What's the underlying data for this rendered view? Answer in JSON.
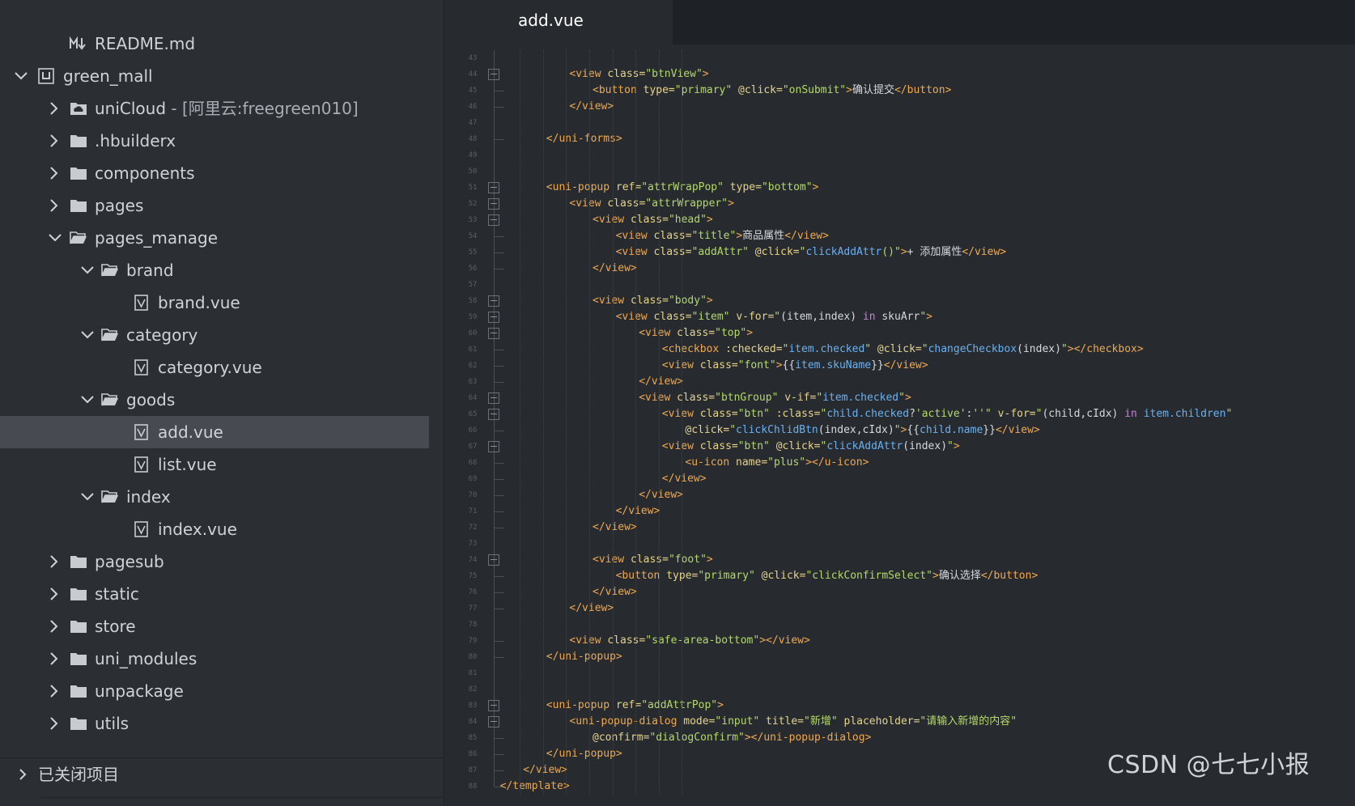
{
  "sidebar": {
    "tree": [
      {
        "label": "README.md",
        "icon": "markdown-icon",
        "depth": 2,
        "chevron": "none"
      },
      {
        "label": "green_mall",
        "icon": "project-icon",
        "depth": 1,
        "chevron": "down"
      },
      {
        "label": "uniCloud",
        "suffix": " - [阿里云:freegreen010]",
        "icon": "cloud-folder-icon",
        "depth": 2,
        "chevron": "right"
      },
      {
        "label": ".hbuilderx",
        "icon": "folder-icon",
        "depth": 2,
        "chevron": "right"
      },
      {
        "label": "components",
        "icon": "folder-icon",
        "depth": 2,
        "chevron": "right"
      },
      {
        "label": "pages",
        "icon": "folder-icon",
        "depth": 2,
        "chevron": "right"
      },
      {
        "label": "pages_manage",
        "icon": "folder-open-icon",
        "depth": 2,
        "chevron": "down"
      },
      {
        "label": "brand",
        "icon": "folder-open-icon",
        "depth": 3,
        "chevron": "down"
      },
      {
        "label": "brand.vue",
        "icon": "vue-file-icon",
        "depth": 4,
        "chevron": "none"
      },
      {
        "label": "category",
        "icon": "folder-open-icon",
        "depth": 3,
        "chevron": "down"
      },
      {
        "label": "category.vue",
        "icon": "vue-file-icon",
        "depth": 4,
        "chevron": "none"
      },
      {
        "label": "goods",
        "icon": "folder-open-icon",
        "depth": 3,
        "chevron": "down"
      },
      {
        "label": "add.vue",
        "icon": "vue-file-icon",
        "depth": 4,
        "chevron": "none",
        "selected": true
      },
      {
        "label": "list.vue",
        "icon": "vue-file-icon",
        "depth": 4,
        "chevron": "none"
      },
      {
        "label": "index",
        "icon": "folder-open-icon",
        "depth": 3,
        "chevron": "down"
      },
      {
        "label": "index.vue",
        "icon": "vue-file-icon",
        "depth": 4,
        "chevron": "none"
      },
      {
        "label": "pagesub",
        "icon": "folder-icon",
        "depth": 2,
        "chevron": "right"
      },
      {
        "label": "static",
        "icon": "folder-icon",
        "depth": 2,
        "chevron": "right"
      },
      {
        "label": "store",
        "icon": "folder-icon",
        "depth": 2,
        "chevron": "right"
      },
      {
        "label": "uni_modules",
        "icon": "folder-icon",
        "depth": 2,
        "chevron": "right"
      },
      {
        "label": "unpackage",
        "icon": "folder-icon",
        "depth": 2,
        "chevron": "right"
      },
      {
        "label": "utils",
        "icon": "folder-icon",
        "depth": 2,
        "chevron": "right"
      }
    ],
    "closed_projects_label": "已关闭项目"
  },
  "editor": {
    "tab_label": "add.vue",
    "first_line_number": 43,
    "fold_lines": [
      44,
      51,
      52,
      53,
      58,
      59,
      60,
      64,
      65,
      67,
      74,
      83,
      84
    ],
    "lines": [
      [],
      [
        [
          "t",
          "<view"
        ],
        [
          "a",
          " class="
        ],
        [
          "s",
          "\"btnView\""
        ],
        [
          "t",
          ">"
        ]
      ],
      [
        [
          "t",
          "<button"
        ],
        [
          "a",
          " type="
        ],
        [
          "s",
          "\"primary\""
        ],
        [
          "a",
          " @click="
        ],
        [
          "s",
          "\"onSubmit\""
        ],
        [
          "t",
          ">"
        ],
        [
          "x",
          "确认提交"
        ],
        [
          "t",
          "</button>"
        ]
      ],
      [
        [
          "t",
          "</view>"
        ]
      ],
      [],
      [
        [
          "t",
          "</uni-forms>"
        ]
      ],
      [],
      [],
      [
        [
          "t",
          "<uni-popup"
        ],
        [
          "a",
          " ref="
        ],
        [
          "s",
          "\"attrWrapPop\""
        ],
        [
          "a",
          " type="
        ],
        [
          "s",
          "\"bottom\""
        ],
        [
          "t",
          ">"
        ]
      ],
      [
        [
          "t",
          "<view"
        ],
        [
          "a",
          " class="
        ],
        [
          "s",
          "\"attrWrapper\""
        ],
        [
          "t",
          ">"
        ]
      ],
      [
        [
          "t",
          "<view"
        ],
        [
          "a",
          " class="
        ],
        [
          "s",
          "\"head\""
        ],
        [
          "t",
          ">"
        ]
      ],
      [
        [
          "t",
          "<view"
        ],
        [
          "a",
          " class="
        ],
        [
          "s",
          "\"title\""
        ],
        [
          "t",
          ">"
        ],
        [
          "x",
          "商品属性"
        ],
        [
          "t",
          "</view>"
        ]
      ],
      [
        [
          "t",
          "<view"
        ],
        [
          "a",
          " class="
        ],
        [
          "s",
          "\"addAttr\""
        ],
        [
          "a",
          " @click="
        ],
        [
          "s",
          "\""
        ],
        [
          "f",
          "clickAddAttr"
        ],
        [
          "s",
          "()\""
        ],
        [
          "t",
          ">"
        ],
        [
          "x",
          "+ 添加属性"
        ],
        [
          "t",
          "</view>"
        ]
      ],
      [
        [
          "t",
          "</view>"
        ]
      ],
      [],
      [
        [
          "t",
          "<view"
        ],
        [
          "a",
          " class="
        ],
        [
          "s",
          "\"body\""
        ],
        [
          "t",
          ">"
        ]
      ],
      [
        [
          "t",
          "<view"
        ],
        [
          "a",
          " class="
        ],
        [
          "s",
          "\"item\""
        ],
        [
          "a",
          " v-for="
        ],
        [
          "s",
          "\""
        ],
        [
          "x",
          "(item,index) "
        ],
        [
          "k",
          "in"
        ],
        [
          "x",
          " skuArr"
        ],
        [
          "s",
          "\""
        ],
        [
          "t",
          ">"
        ]
      ],
      [
        [
          "t",
          "<view"
        ],
        [
          "a",
          " class="
        ],
        [
          "s",
          "\"top\""
        ],
        [
          "t",
          ">"
        ]
      ],
      [
        [
          "t",
          "<checkbox"
        ],
        [
          "a",
          " :checked="
        ],
        [
          "s",
          "\""
        ],
        [
          "v",
          "item.checked"
        ],
        [
          "s",
          "\""
        ],
        [
          "a",
          " @click="
        ],
        [
          "s",
          "\""
        ],
        [
          "f",
          "changeCheckbox"
        ],
        [
          "x",
          "(index)"
        ],
        [
          "s",
          "\""
        ],
        [
          "t",
          "></checkbox>"
        ]
      ],
      [
        [
          "t",
          "<view"
        ],
        [
          "a",
          " class="
        ],
        [
          "s",
          "\"font\""
        ],
        [
          "t",
          ">"
        ],
        [
          "x",
          "{{"
        ],
        [
          "v",
          "item.skuName"
        ],
        [
          "x",
          "}}"
        ],
        [
          "t",
          "</view>"
        ]
      ],
      [
        [
          "t",
          "</view>"
        ]
      ],
      [
        [
          "t",
          "<view"
        ],
        [
          "a",
          " class="
        ],
        [
          "s",
          "\"btnGroup\""
        ],
        [
          "a",
          " v-if="
        ],
        [
          "s",
          "\""
        ],
        [
          "v",
          "item.checked"
        ],
        [
          "s",
          "\""
        ],
        [
          "t",
          ">"
        ]
      ],
      [
        [
          "t",
          "<view"
        ],
        [
          "a",
          " class="
        ],
        [
          "s",
          "\"btn\""
        ],
        [
          "a",
          " :class="
        ],
        [
          "s",
          "\""
        ],
        [
          "v",
          "child.checked"
        ],
        [
          "x",
          "?"
        ],
        [
          "s",
          "'active'"
        ],
        [
          "x",
          ":"
        ],
        [
          "s",
          "''"
        ],
        [
          "s",
          "\""
        ],
        [
          "a",
          " v-for="
        ],
        [
          "s",
          "\""
        ],
        [
          "x",
          "(child,cIdx) "
        ],
        [
          "k",
          "in"
        ],
        [
          "v",
          " item.children"
        ],
        [
          "s",
          "\""
        ]
      ],
      [
        [
          "a",
          "@click="
        ],
        [
          "s",
          "\""
        ],
        [
          "f",
          "clickChlidBtn"
        ],
        [
          "x",
          "(index,cIdx)"
        ],
        [
          "s",
          "\""
        ],
        [
          "t",
          ">"
        ],
        [
          "x",
          "{{"
        ],
        [
          "v",
          "child.name"
        ],
        [
          "x",
          "}}"
        ],
        [
          "t",
          "</view>"
        ]
      ],
      [
        [
          "t",
          "<view"
        ],
        [
          "a",
          " class="
        ],
        [
          "s",
          "\"btn\""
        ],
        [
          "a",
          " @click="
        ],
        [
          "s",
          "\""
        ],
        [
          "f",
          "clickAddAttr"
        ],
        [
          "x",
          "(index)"
        ],
        [
          "s",
          "\""
        ],
        [
          "t",
          ">"
        ]
      ],
      [
        [
          "t",
          "<u-icon"
        ],
        [
          "a",
          " name="
        ],
        [
          "s",
          "\"plus\""
        ],
        [
          "t",
          "></u-icon>"
        ]
      ],
      [
        [
          "t",
          "</view>"
        ]
      ],
      [
        [
          "t",
          "</view>"
        ]
      ],
      [
        [
          "t",
          "</view>"
        ]
      ],
      [
        [
          "t",
          "</view>"
        ]
      ],
      [],
      [
        [
          "t",
          "<view"
        ],
        [
          "a",
          " class="
        ],
        [
          "s",
          "\"foot\""
        ],
        [
          "t",
          ">"
        ]
      ],
      [
        [
          "t",
          "<button"
        ],
        [
          "a",
          " type="
        ],
        [
          "s",
          "\"primary\""
        ],
        [
          "a",
          " @click="
        ],
        [
          "s",
          "\"clickConfirmSelect\""
        ],
        [
          "t",
          ">"
        ],
        [
          "x",
          "确认选择"
        ],
        [
          "t",
          "</button>"
        ]
      ],
      [
        [
          "t",
          "</view>"
        ]
      ],
      [
        [
          "t",
          "</view>"
        ]
      ],
      [],
      [
        [
          "t",
          "<view"
        ],
        [
          "a",
          " class="
        ],
        [
          "s",
          "\"safe-area-bottom\""
        ],
        [
          "t",
          "></view>"
        ]
      ],
      [
        [
          "t",
          "</uni-popup>"
        ]
      ],
      [],
      [],
      [
        [
          "t",
          "<uni-popup"
        ],
        [
          "a",
          " ref="
        ],
        [
          "s",
          "\"addAttrPop\""
        ],
        [
          "t",
          ">"
        ]
      ],
      [
        [
          "t",
          "<uni-popup-dialog"
        ],
        [
          "a",
          " mode="
        ],
        [
          "s",
          "\"input\""
        ],
        [
          "a",
          " title="
        ],
        [
          "s",
          "\"新增\""
        ],
        [
          "a",
          " placeholder="
        ],
        [
          "s",
          "\"请输入新增的内容\""
        ]
      ],
      [
        [
          "a",
          "@confirm="
        ],
        [
          "s",
          "\"dialogConfirm\""
        ],
        [
          "t",
          "></uni-popup-dialog>"
        ]
      ],
      [
        [
          "t",
          "</uni-popup>"
        ]
      ],
      [
        [
          "t",
          "</view>"
        ]
      ],
      [
        [
          "t",
          "</template>"
        ]
      ]
    ]
  },
  "watermark": "CSDN @七七小报"
}
